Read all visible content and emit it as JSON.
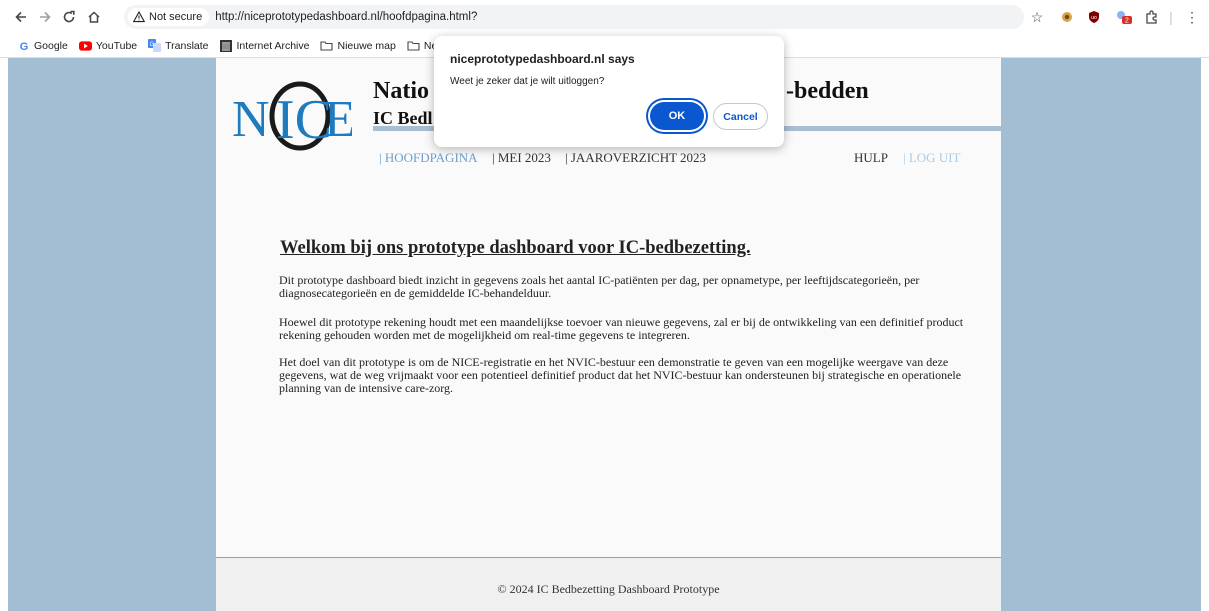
{
  "browser": {
    "security_label": "Not secure",
    "url": "http://niceprototypedashboard.nl/hoofdpagina.html?",
    "extension_badge": "2",
    "bookmarks": [
      {
        "label": "Google"
      },
      {
        "label": "YouTube"
      },
      {
        "label": "Translate"
      },
      {
        "label": "Internet Archive"
      },
      {
        "label": "Nieuwe map"
      },
      {
        "label": "New"
      }
    ]
  },
  "page": {
    "title_left": "Natio",
    "title_right": "-bedden",
    "subtitle": "IC Bedl",
    "nav": {
      "home": "| HOOFDPAGINA",
      "month": "| MEI 2023",
      "year": "| JAAROVERZICHT 2023",
      "help": "HULP",
      "logout": "| LOG UIT"
    },
    "welcome": "Welkom bij ons prototype dashboard voor IC-bedbezetting.",
    "paragraphs": [
      "Dit prototype dashboard biedt inzicht in gegevens zoals het aantal IC-patiënten per dag, per opnametype, per leeftijdscategorieën, per diagnosecategorieën en de gemiddelde IC-behandelduur.",
      "Hoewel dit prototype rekening houdt met een maandelijkse toevoer van nieuwe gegevens, zal er bij de ontwikkeling van een definitief product rekening gehouden worden met de mogelijkheid om real-time gegevens te integreren.",
      "Het doel van dit prototype is om de NICE-registratie en het NVIC-bestuur een demonstratie te geven van een mogelijke weergave van deze gegevens, wat de weg vrijmaakt voor een potentieel definitief product dat het NVIC-bestuur kan ondersteunen bij strategische en operationele planning van de intensive care-zorg."
    ],
    "footer": "© 2024 IC Bedbezetting Dashboard Prototype"
  },
  "dialog": {
    "title": "niceprototypedashboard.nl says",
    "message": "Weet je zeker dat je wilt uitloggen?",
    "ok_label": "OK",
    "cancel_label": "Cancel"
  },
  "colors": {
    "page_background": "#a3bdd2",
    "nav_link": "#6fa0cc",
    "logout_link": "#a9cce7",
    "ok_button": "#0b57d0"
  }
}
